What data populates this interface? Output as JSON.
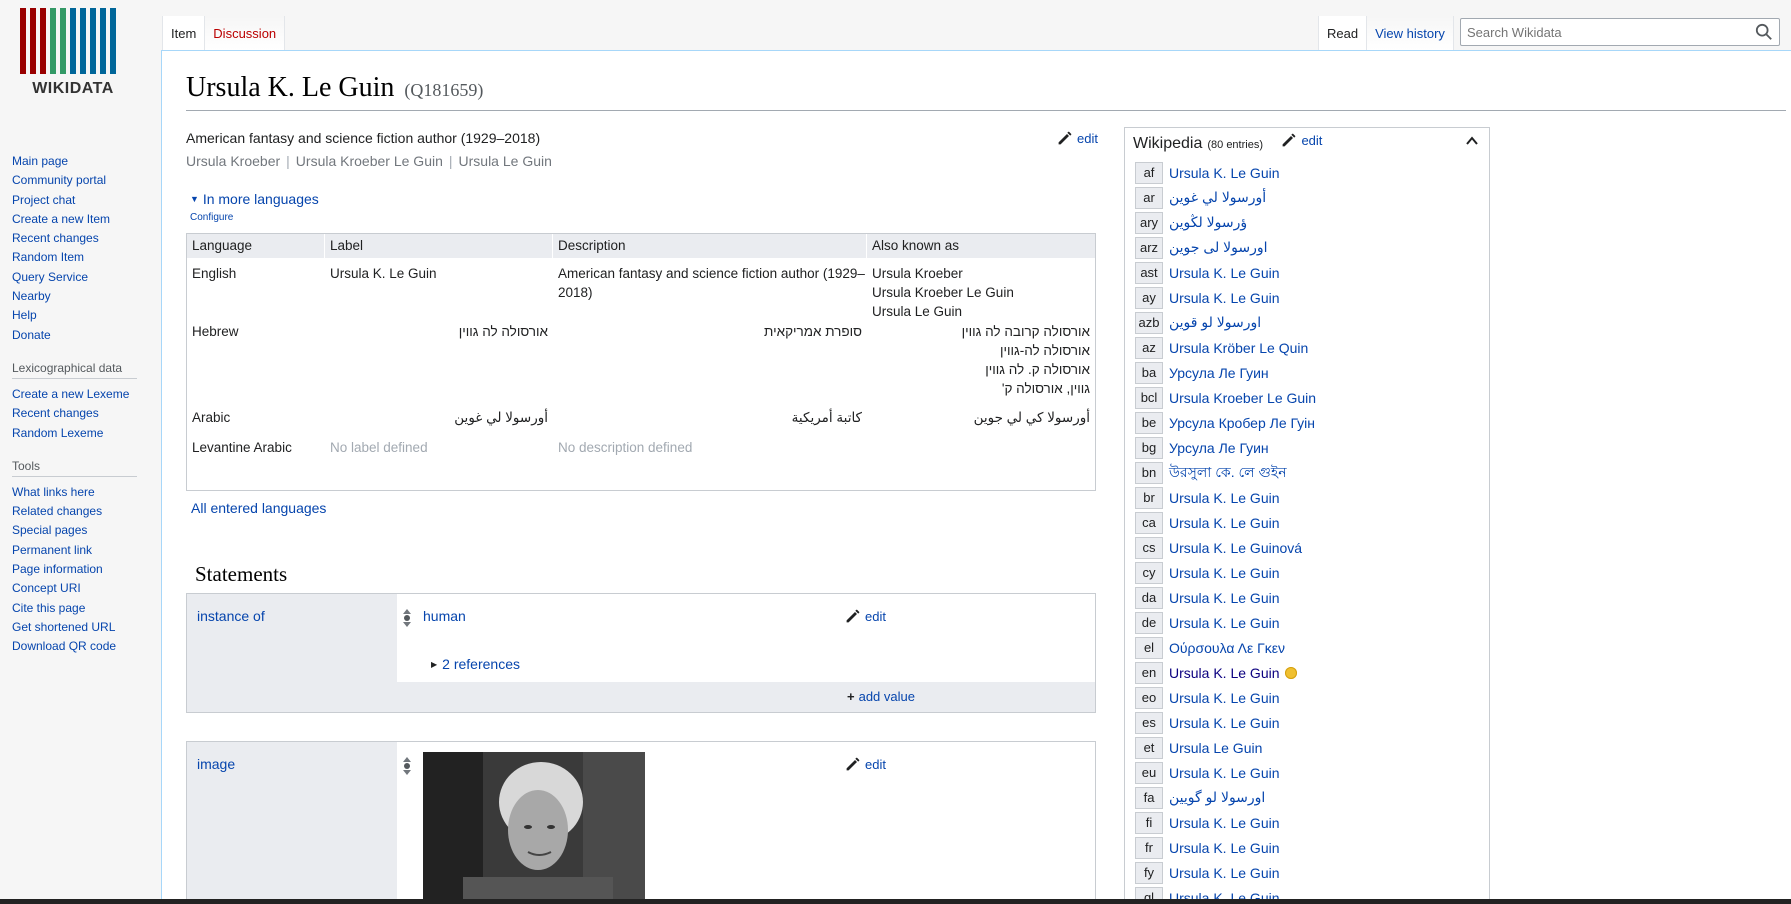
{
  "logo": {
    "wordmark": "WIKIDATA",
    "bar_colors": [
      "#990000",
      "#990000",
      "#990000",
      "#339966",
      "#339966",
      "#006699",
      "#006699",
      "#006699",
      "#006699",
      "#006699"
    ]
  },
  "sidebar": {
    "nav": [
      "Main page",
      "Community portal",
      "Project chat",
      "Create a new Item",
      "Recent changes",
      "Random Item",
      "Query Service",
      "Nearby",
      "Help",
      "Donate"
    ],
    "lexico_heading": "Lexicographical data",
    "lexico": [
      "Create a new Lexeme",
      "Recent changes",
      "Random Lexeme"
    ],
    "tools_heading": "Tools",
    "tools": [
      "What links here",
      "Related changes",
      "Special pages",
      "Permanent link",
      "Page information",
      "Concept URI",
      "Cite this page",
      "Get shortened URL",
      "Download QR code"
    ]
  },
  "tabs": {
    "item": "Item",
    "discussion": "Discussion",
    "read": "Read",
    "history": "View history"
  },
  "search": {
    "placeholder": "Search Wikidata"
  },
  "title": {
    "label": "Ursula K. Le Guin",
    "qid": "(Q181659)"
  },
  "description": "American fantasy and science fiction author (1929–2018)",
  "aliases": [
    "Ursula Kroeber",
    "Ursula Kroeber Le Guin",
    "Ursula Le Guin"
  ],
  "edit_label": "edit",
  "more_languages": "In more languages",
  "configure": "Configure",
  "lang_table": {
    "headers": [
      "Language",
      "Label",
      "Description",
      "Also known as"
    ],
    "rows": [
      {
        "lang": "English",
        "label": "Ursula K. Le Guin",
        "desc": "American fantasy and science fiction author (1929–2018)",
        "aka": [
          "Ursula Kroeber",
          "Ursula Kroeber Le Guin",
          "Ursula Le Guin"
        ]
      },
      {
        "lang": "Hebrew",
        "label": "אורסולה לה גווין",
        "desc": "סופרת אמריקאית",
        "aka": [
          "אורסולה קרובה לה גווין",
          "אורסולה לה-גווין",
          "אורסולה ק. לה גווין",
          "גווין, אורסולה ק'"
        ]
      },
      {
        "lang": "Arabic",
        "label": "أورسولا لي غوين",
        "desc": "كاتبة أمريكية",
        "aka": [
          "أورسولا كي لي جوين"
        ]
      },
      {
        "lang": "Levantine Arabic",
        "label": "No label defined",
        "desc": "No description defined",
        "aka": []
      }
    ]
  },
  "all_languages": "All entered languages",
  "statements_heading": "Statements",
  "statements": [
    {
      "property": "instance of",
      "value": "human",
      "references": "2 references",
      "add_value": "add value"
    },
    {
      "property": "image"
    }
  ],
  "wikipedia": {
    "title": "Wikipedia",
    "count": "(80 entries)",
    "entries": [
      {
        "code": "af",
        "title": "Ursula K. Le Guin"
      },
      {
        "code": "ar",
        "title": "أورسولا لي غوين"
      },
      {
        "code": "ary",
        "title": "ؤرسولا لڭوين"
      },
      {
        "code": "arz",
        "title": "اورسولا لى جوين"
      },
      {
        "code": "ast",
        "title": "Ursula K. Le Guin"
      },
      {
        "code": "ay",
        "title": "Ursula K. Le Guin"
      },
      {
        "code": "azb",
        "title": "اورسولا لو قوین"
      },
      {
        "code": "az",
        "title": "Ursula Kröber Le Quin"
      },
      {
        "code": "ba",
        "title": "Урсула Ле Гуин"
      },
      {
        "code": "bcl",
        "title": "Ursula Kroeber Le Guin"
      },
      {
        "code": "be",
        "title": "Урсула Кробер Ле Гуін"
      },
      {
        "code": "bg",
        "title": "Урсула Ле Гуин"
      },
      {
        "code": "bn",
        "title": "উরসুলা কে. লে গুইন"
      },
      {
        "code": "br",
        "title": "Ursula K. Le Guin"
      },
      {
        "code": "ca",
        "title": "Ursula K. Le Guin"
      },
      {
        "code": "cs",
        "title": "Ursula K. Le Guinová"
      },
      {
        "code": "cy",
        "title": "Ursula K. Le Guin"
      },
      {
        "code": "da",
        "title": "Ursula K. Le Guin"
      },
      {
        "code": "de",
        "title": "Ursula K. Le Guin"
      },
      {
        "code": "el",
        "title": "Ούρσουλα Λε Γκεν"
      },
      {
        "code": "en",
        "title": "Ursula K. Le Guin"
      },
      {
        "code": "eo",
        "title": "Ursula K. Le Guin"
      },
      {
        "code": "es",
        "title": "Ursula K. Le Guin"
      },
      {
        "code": "et",
        "title": "Ursula Le Guin"
      },
      {
        "code": "eu",
        "title": "Ursula K. Le Guin"
      },
      {
        "code": "fa",
        "title": "اورسولا لو گویین"
      },
      {
        "code": "fi",
        "title": "Ursula K. Le Guin"
      },
      {
        "code": "fr",
        "title": "Ursula K. Le Guin"
      },
      {
        "code": "fy",
        "title": "Ursula K. Le Guin"
      },
      {
        "code": "gl",
        "title": "Ursula K. Le Guin"
      }
    ]
  }
}
